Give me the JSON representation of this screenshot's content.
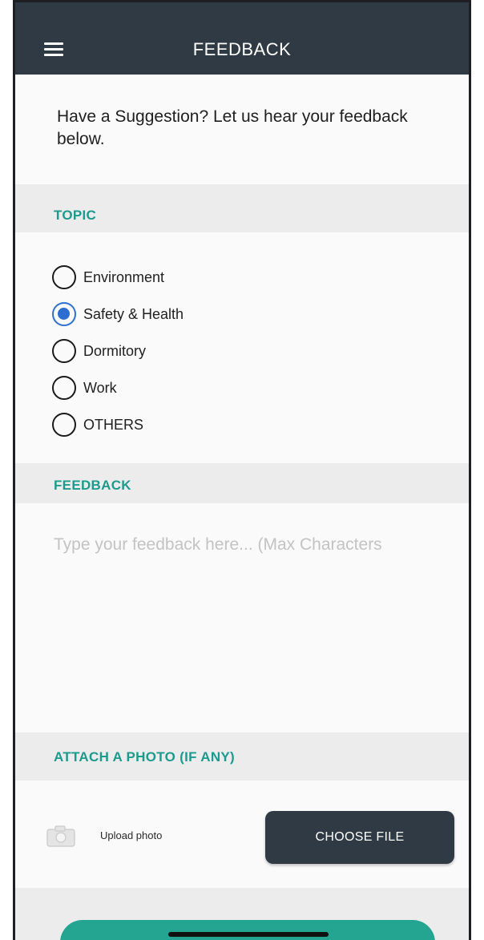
{
  "header": {
    "title": "FEEDBACK",
    "menu_icon": "hamburger-menu-icon"
  },
  "intro_text": "Have a Suggestion? Let us hear your feedback below.",
  "topic": {
    "label": "TOPIC",
    "options": [
      {
        "label": "Environment",
        "selected": false
      },
      {
        "label": "Safety & Health",
        "selected": true
      },
      {
        "label": "Dormitory",
        "selected": false
      },
      {
        "label": "Work",
        "selected": false
      },
      {
        "label": "OTHERS",
        "selected": false
      }
    ]
  },
  "feedback": {
    "label": "FEEDBACK",
    "value": "",
    "placeholder": "Type your feedback here... (Max Characters"
  },
  "attach": {
    "label": "ATTACH A PHOTO (IF ANY)",
    "upload_label": "Upload photo",
    "upload_icon": "camera-icon",
    "choose_file_label": "CHOOSE FILE"
  },
  "colors": {
    "header_bg": "#2f3a44",
    "accent": "#1c9b8c",
    "radio_selected": "#2d6fd0",
    "submit_bg": "#24a592"
  }
}
